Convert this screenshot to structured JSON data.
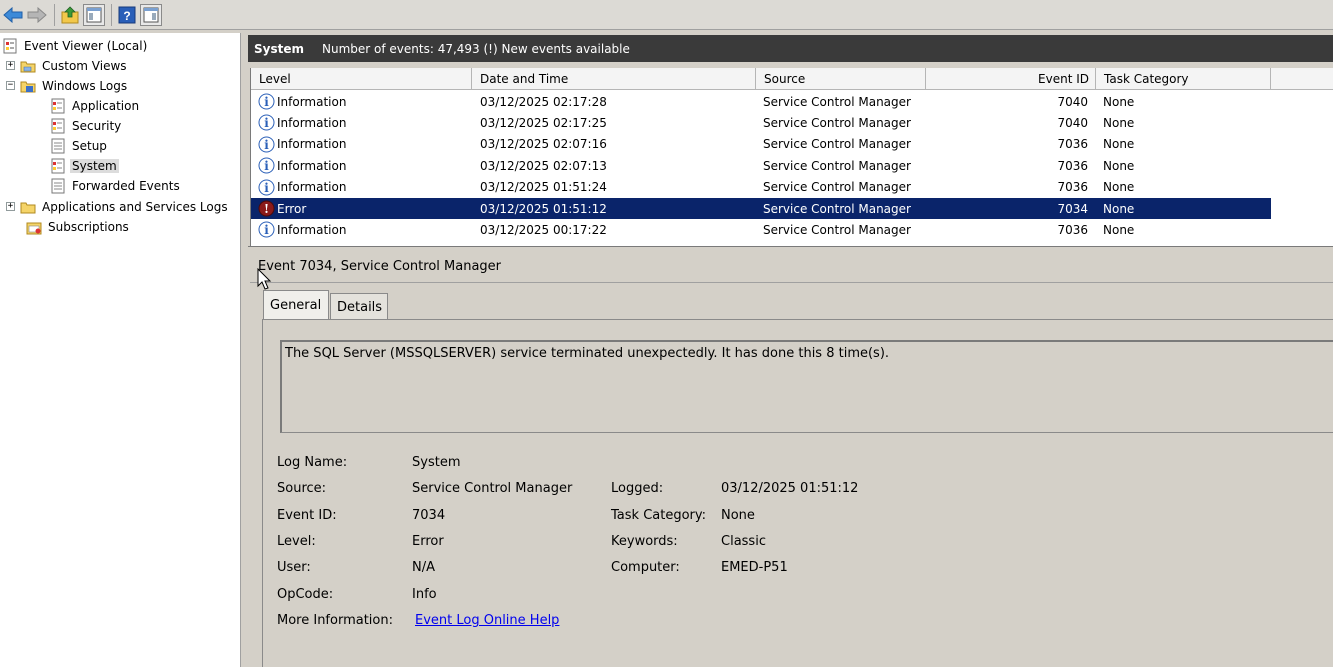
{
  "toolbar": {
    "buttons": [
      "back-arrow-icon",
      "forward-arrow-icon",
      "up-folder-icon",
      "show-hide-tree-icon",
      "help-icon",
      "action-pane-icon"
    ]
  },
  "tree": {
    "root": "Event Viewer (Local)",
    "custom_views": "Custom Views",
    "windows_logs": "Windows Logs",
    "application": "Application",
    "security": "Security",
    "setup": "Setup",
    "system": "System",
    "forwarded": "Forwarded Events",
    "apps_services": "Applications and Services Logs",
    "subscriptions": "Subscriptions",
    "expander_plus": "+",
    "expander_minus": "−"
  },
  "header": {
    "title": "System",
    "count": "Number of events: 47,493 (!) New events available"
  },
  "columns": [
    "Level",
    "Date and Time",
    "Source",
    "Event ID",
    "Task Category"
  ],
  "events": [
    {
      "level": "Information",
      "icon": "info-icon",
      "datetime": "03/12/2025 02:17:28",
      "source": "Service Control Manager",
      "event_id": "7040",
      "category": "None"
    },
    {
      "level": "Information",
      "icon": "info-icon",
      "datetime": "03/12/2025 02:17:25",
      "source": "Service Control Manager",
      "event_id": "7040",
      "category": "None"
    },
    {
      "level": "Information",
      "icon": "info-icon",
      "datetime": "03/12/2025 02:07:16",
      "source": "Service Control Manager",
      "event_id": "7036",
      "category": "None"
    },
    {
      "level": "Information",
      "icon": "info-icon",
      "datetime": "03/12/2025 02:07:13",
      "source": "Service Control Manager",
      "event_id": "7036",
      "category": "None"
    },
    {
      "level": "Information",
      "icon": "info-icon",
      "datetime": "03/12/2025 01:51:24",
      "source": "Service Control Manager",
      "event_id": "7036",
      "category": "None"
    },
    {
      "level": "Error",
      "icon": "error-icon",
      "datetime": "03/12/2025 01:51:12",
      "source": "Service Control Manager",
      "event_id": "7034",
      "category": "None",
      "selected": true
    },
    {
      "level": "Information",
      "icon": "info-icon",
      "datetime": "03/12/2025 00:17:22",
      "source": "Service Control Manager",
      "event_id": "7036",
      "category": "None"
    }
  ],
  "detail": {
    "title": "Event 7034, Service Control Manager",
    "tabs": [
      "General",
      "Details"
    ],
    "message": "The SQL Server (MSSQLSERVER) service terminated unexpectedly.  It has done this 8 time(s).",
    "labels": {
      "log_name": "Log Name:",
      "source": "Source:",
      "event_id": "Event ID:",
      "level": "Level:",
      "user": "User:",
      "opcode": "OpCode:",
      "more_info": "More Information:",
      "logged": "Logged:",
      "task_category": "Task Category:",
      "keywords": "Keywords:",
      "computer": "Computer:"
    },
    "values": {
      "log_name": "System",
      "source": "Service Control Manager",
      "event_id": "7034",
      "level": "Error",
      "user": "N/A",
      "opcode": "Info",
      "more_info_link": "Event Log Online Help",
      "logged": "03/12/2025 01:51:12",
      "task_category": "None",
      "keywords": "Classic",
      "computer": "EMED-P51"
    }
  },
  "colors": {
    "selection": "#0a246a",
    "header_bg": "#3a3a3a",
    "link": "#0000ee"
  }
}
